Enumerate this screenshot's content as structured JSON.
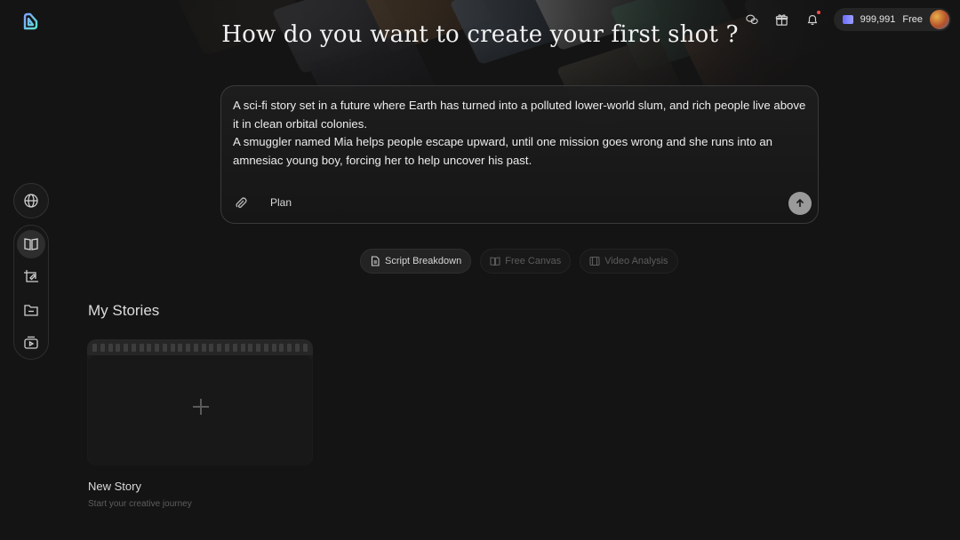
{
  "app": {
    "logo_icon": "app-logo-icon",
    "accent": "#6d8bff"
  },
  "header": {
    "title": "How do you want to create your first shot ?",
    "credits": "999,991",
    "plan": "Free",
    "icons": [
      "wechat-icon",
      "gift-icon",
      "bell-icon"
    ]
  },
  "rail": {
    "top_icon": "globe-icon",
    "items": [
      {
        "icon": "book-icon",
        "active": true
      },
      {
        "icon": "crop-edit-icon",
        "active": false
      },
      {
        "icon": "folder-icon",
        "active": false
      },
      {
        "icon": "tv-play-icon",
        "active": false
      }
    ]
  },
  "prompt": {
    "line1": "A sci-fi story set in a future where Earth has turned into a polluted lower-world slum, and rich people live above it in clean orbital colonies.",
    "line2": "A smuggler named Mia helps people escape upward, until one mission goes wrong and she runs into an amnesiac young boy, forcing her to help uncover his past.",
    "plan_label": "Plan"
  },
  "modes": [
    {
      "label": "Script Breakdown",
      "icon": "document-icon",
      "active": true
    },
    {
      "label": "Free Canvas",
      "icon": "open-book-icon",
      "active": false
    },
    {
      "label": "Video Analysis",
      "icon": "film-icon",
      "active": false
    }
  ],
  "stories": {
    "title": "My Stories",
    "new_name": "New Story",
    "new_sub": "Start your creative journey"
  }
}
